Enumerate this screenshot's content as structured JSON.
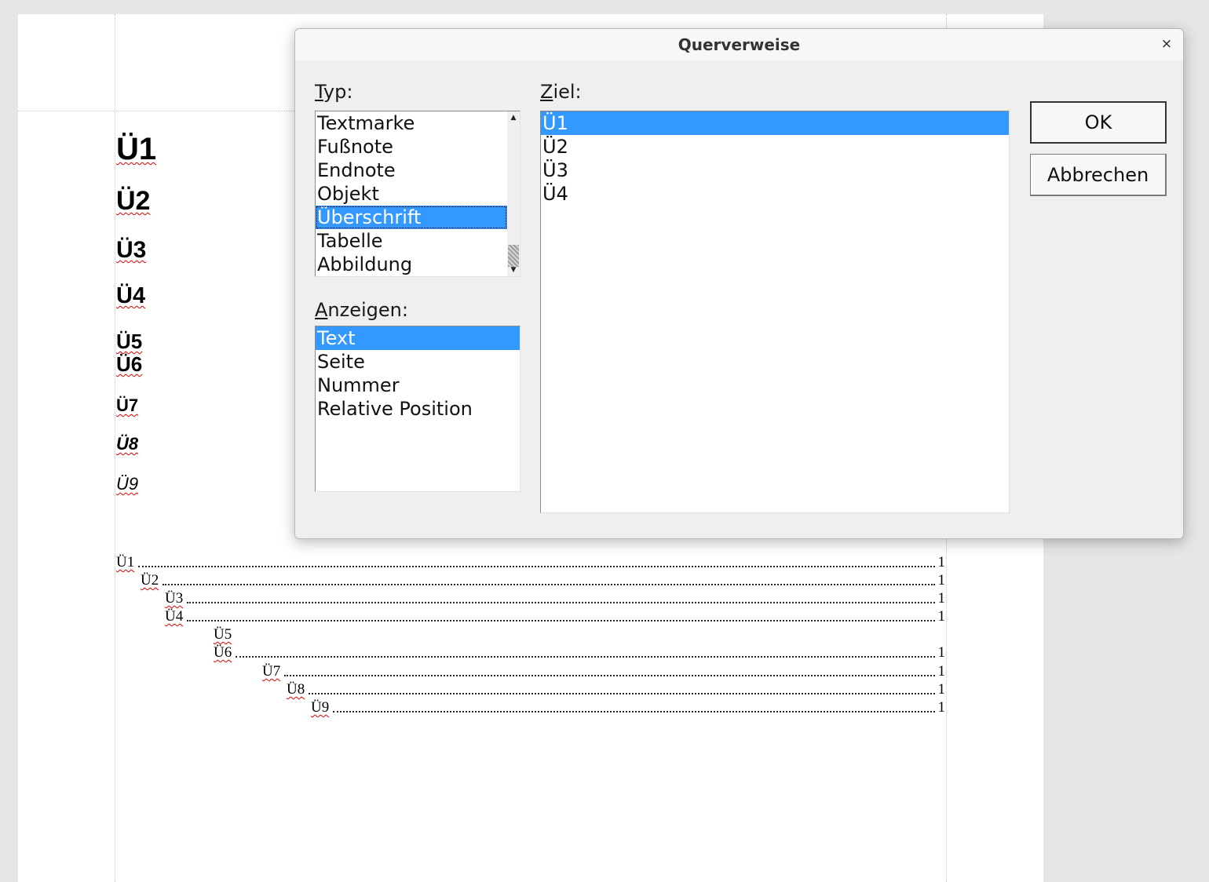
{
  "document": {
    "headings": [
      "Ü1",
      "Ü2",
      "Ü3",
      "Ü4",
      "Ü5",
      "Ü6",
      "Ü7",
      "Ü8",
      "Ü9"
    ],
    "toc": [
      {
        "label": "Ü1",
        "page": "1"
      },
      {
        "label": "Ü2",
        "page": "1"
      },
      {
        "label": "Ü3",
        "page": "1"
      },
      {
        "label": "Ü4",
        "page": "1"
      },
      {
        "label": "Ü5",
        "page": ""
      },
      {
        "label": "Ü6",
        "page": "1"
      },
      {
        "label": "Ü7",
        "page": "1"
      },
      {
        "label": "Ü8",
        "page": "1"
      },
      {
        "label": "Ü9",
        "page": "1"
      }
    ]
  },
  "dialog": {
    "title": "Querverweise",
    "close_label": "×",
    "typ": {
      "label_first": "T",
      "label_rest": "yp:",
      "items": [
        "Textmarke",
        "Fußnote",
        "Endnote",
        "Objekt",
        "Überschrift",
        "Tabelle",
        "Abbildung"
      ],
      "selected": "Überschrift"
    },
    "anzeigen": {
      "label_first": "A",
      "label_rest": "nzeigen:",
      "items": [
        "Text",
        "Seite",
        "Nummer",
        "Relative Position"
      ],
      "selected": "Text"
    },
    "ziel": {
      "label_first": "Z",
      "label_rest": "iel:",
      "items": [
        "Ü1",
        "Ü2",
        "Ü3",
        "Ü4"
      ],
      "selected": "Ü1"
    },
    "buttons": {
      "ok": "OK",
      "cancel": "Abbrechen"
    },
    "colors": {
      "selection": "#3399ff"
    }
  }
}
